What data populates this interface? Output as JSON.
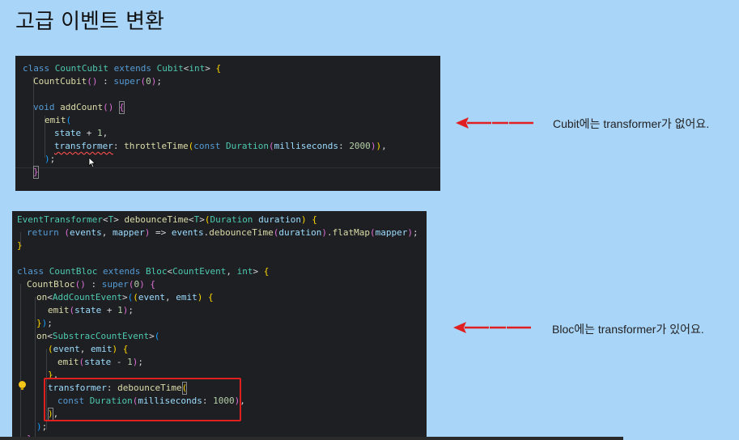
{
  "slide": {
    "title": "고급 이벤트 변환"
  },
  "annotations": {
    "cubit_note": "Cubit에는 transformer가 없어요.",
    "bloc_note": "Bloc에는 transformer가 있어요."
  },
  "colors": {
    "background": "#a9d5f9",
    "editor_bg": "#1e1f22",
    "arrow_red": "#e02020",
    "highlight_red": "#e02020"
  },
  "icons": {
    "lightbulb": "lightbulb-icon",
    "cursor": "mouse-pointer-icon",
    "arrow": "left-arrow-icon"
  }
}
